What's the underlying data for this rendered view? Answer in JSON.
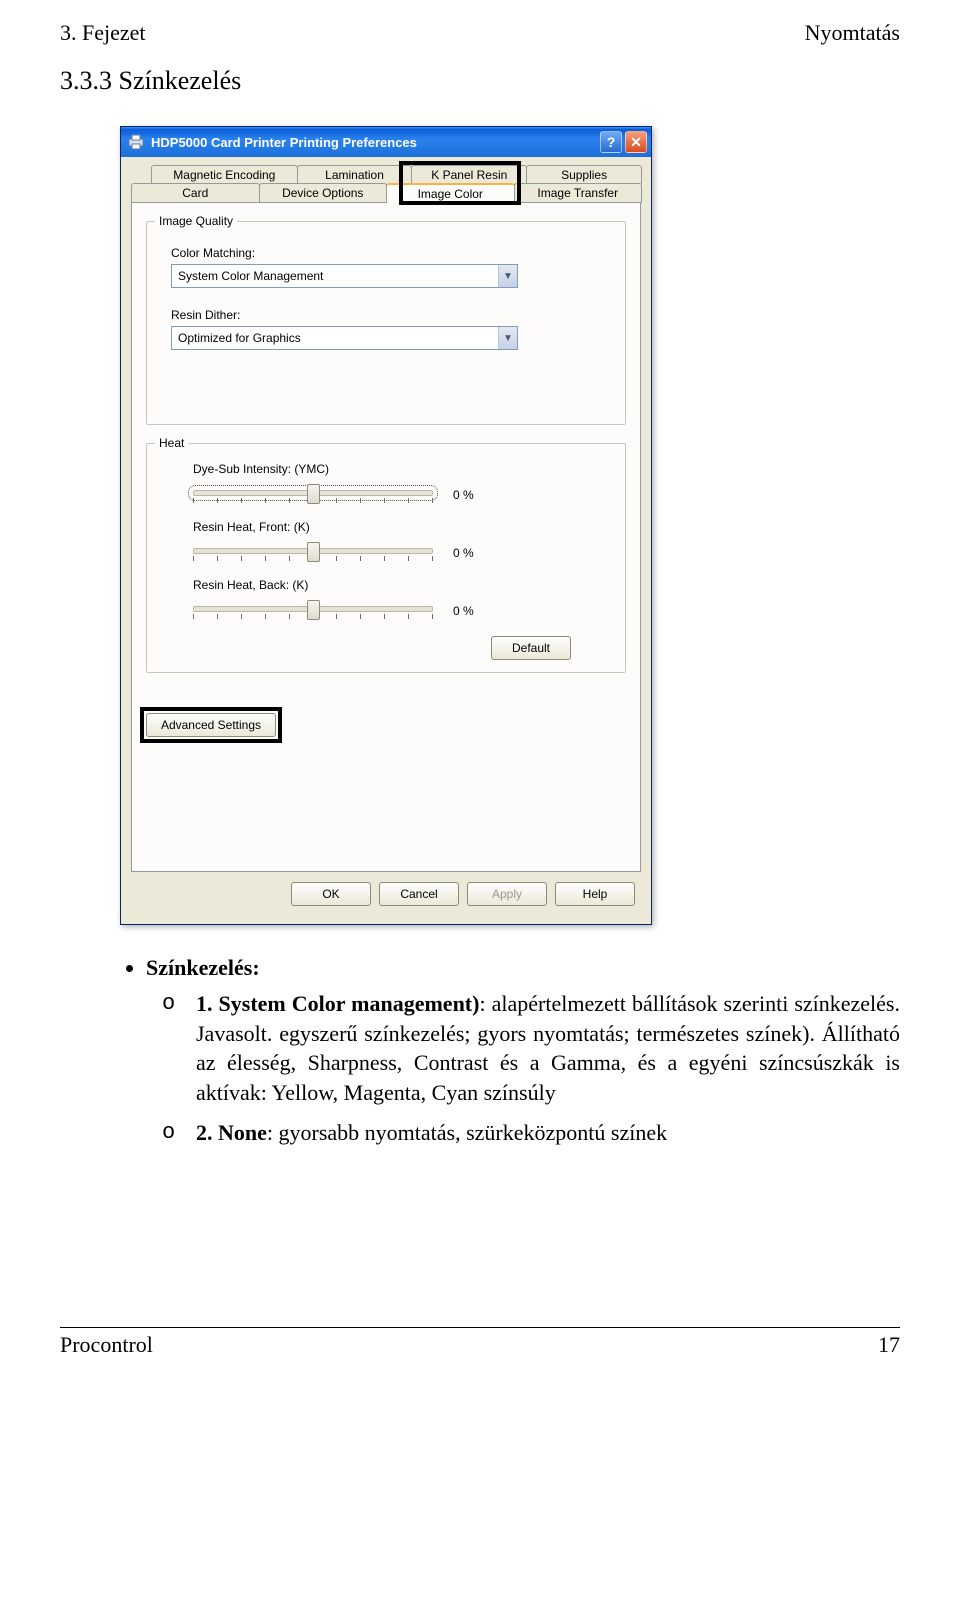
{
  "header": {
    "left": "3. Fejezet",
    "right": "Nyomtatás"
  },
  "section_title": "3.3.3 Színkezelés",
  "window": {
    "title": "HDP5000 Card Printer Printing Preferences",
    "help_btn": "?",
    "close_btn": "✕",
    "tabs_top": [
      "Magnetic Encoding",
      "Lamination",
      "K Panel Resin",
      "Supplies"
    ],
    "tabs_bottom": [
      "Card",
      "Device Options",
      "Image Color",
      "Image Transfer"
    ],
    "active_tab": "Image Color",
    "image_quality": {
      "legend": "Image Quality",
      "color_matching_label": "Color Matching:",
      "color_matching_value": "System Color Management",
      "resin_dither_label": "Resin Dither:",
      "resin_dither_value": "Optimized for Graphics"
    },
    "heat": {
      "legend": "Heat",
      "sliders": [
        {
          "label": "Dye-Sub Intensity:  (YMC)",
          "value": "0  %"
        },
        {
          "label": "Resin Heat, Front:  (K)",
          "value": "0  %"
        },
        {
          "label": "Resin Heat, Back:   (K)",
          "value": "0  %"
        }
      ],
      "default_btn": "Default"
    },
    "advanced_btn": "Advanced Settings",
    "buttons": {
      "ok": "OK",
      "cancel": "Cancel",
      "apply": "Apply",
      "help": "Help"
    }
  },
  "bullets": {
    "heading": "Színkezelés:",
    "item1_lead": "1. System Color management)",
    "item1_rest": ": alapértelmezett bállítások szerinti színkezelés. Javasolt. egyszerű színkezelés; gyors nyomtatás; természetes színek). Állítható az élesség, Sharpness, Contrast és a Gamma, és a egyéni színcsúszkák is aktívak: Yellow, Magenta, Cyan színsúly",
    "item2_lead": "2. None",
    "item2_rest": ": gyorsabb nyomtatás, szürkeközpontú színek"
  },
  "footer": {
    "left": "Procontrol",
    "right": "17"
  }
}
